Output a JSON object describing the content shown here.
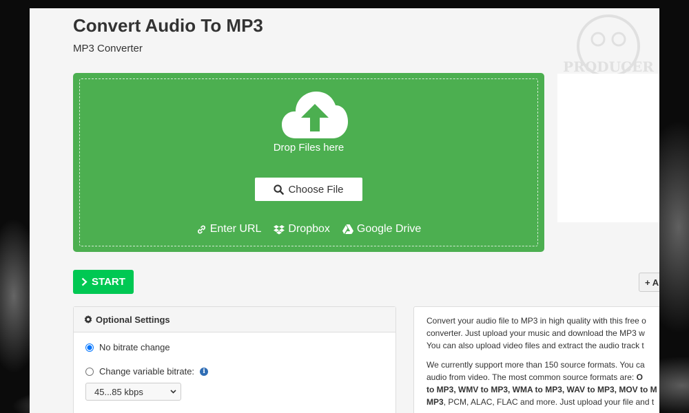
{
  "header": {
    "title": "Convert Audio To MP3",
    "subtitle": "MP3 Converter"
  },
  "dropzone": {
    "drop_label": "Drop Files here",
    "choose_file_label": "Choose File",
    "sources": [
      {
        "label": "Enter URL",
        "icon": "link-icon"
      },
      {
        "label": "Dropbox",
        "icon": "dropbox-icon"
      },
      {
        "label": "Google Drive",
        "icon": "google-drive-icon"
      }
    ],
    "background_color": "#4caf50"
  },
  "actions": {
    "start_label": "START",
    "start_color": "#00c853",
    "add_label": "+ A"
  },
  "settings": {
    "header": "Optional Settings",
    "option_no_change": "No bitrate change",
    "option_variable": "Change variable bitrate:",
    "bitrate_value": "45...85 kbps"
  },
  "description": {
    "lines_p1": [
      "Convert your audio file to MP3 in high quality with this free o",
      "converter. Just upload your music and download the MP3 w",
      "You can also upload video files and extract the audio track t"
    ],
    "p2_line1": "We currently support more than 150 source formats. You ca",
    "p2_line2_prefix": "audio from video. The most common source formats are: ",
    "p2_line2_bold": "O",
    "p2_line3_bold": "to MP3, WMV to MP3, WMA to MP3, WAV to MP3, MOV to M",
    "p2_line4_bold": "MP3",
    "p2_line4_rest": ", PCM, ALAC, FLAC and more. Just upload your file and t"
  },
  "watermark": {
    "text": "PRODUCER"
  }
}
